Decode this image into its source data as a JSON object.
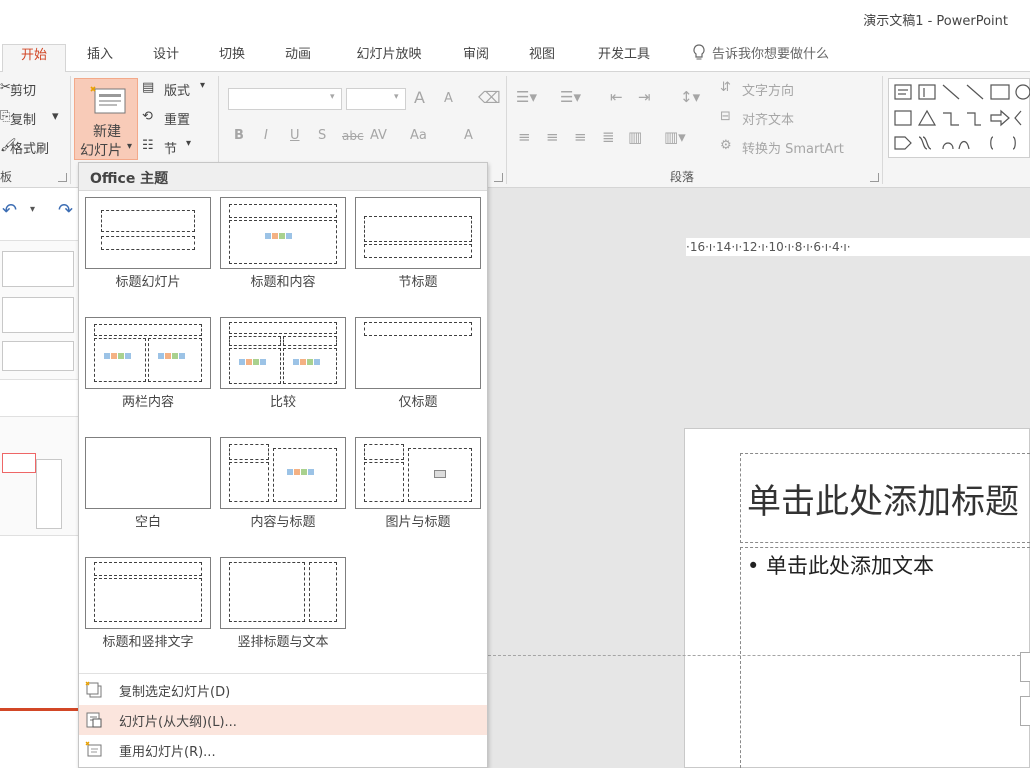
{
  "window": {
    "title": "演示文稿1 - PowerPoint"
  },
  "tabs": [
    {
      "label": "开始",
      "active": true
    },
    {
      "label": "插入"
    },
    {
      "label": "设计"
    },
    {
      "label": "切换"
    },
    {
      "label": "动画"
    },
    {
      "label": "幻灯片放映"
    },
    {
      "label": "审阅"
    },
    {
      "label": "视图"
    },
    {
      "label": "开发工具"
    },
    {
      "label": "告诉我你想要做什么"
    }
  ],
  "ribbon": {
    "clipboard": {
      "cut": "剪切",
      "copy": "复制",
      "format_painter": "格式刷",
      "group_label": "板"
    },
    "slides": {
      "new_slide_line1": "新建",
      "new_slide_line2": "幻灯片",
      "layout": "版式",
      "reset": "重置",
      "section": "节"
    },
    "font": {
      "grow": "A",
      "shrink": "A",
      "bold": "B",
      "italic": "I",
      "underline": "U",
      "shadow": "S",
      "strike": "abc",
      "spacing": "AV",
      "case": "Aa",
      "color": "A"
    },
    "paragraph": {
      "text_direction": "文字方向",
      "align_text": "对齐文本",
      "smartart": "转换为 SmartArt",
      "group_label": "段落"
    }
  },
  "gallery": {
    "header": "Office 主题",
    "layouts": [
      {
        "label": "标题幻灯片"
      },
      {
        "label": "标题和内容"
      },
      {
        "label": "节标题"
      },
      {
        "label": "两栏内容"
      },
      {
        "label": "比较"
      },
      {
        "label": "仅标题"
      },
      {
        "label": "空白"
      },
      {
        "label": "内容与标题"
      },
      {
        "label": "图片与标题"
      },
      {
        "label": "标题和竖排文字"
      },
      {
        "label": "竖排标题与文本"
      }
    ],
    "menu": [
      {
        "label": "复制选定幻灯片(D)",
        "highlighted": false
      },
      {
        "label": "幻灯片(从大纲)(L)...",
        "highlighted": true
      },
      {
        "label": "重用幻灯片(R)..."
      }
    ]
  },
  "ruler": {
    "text": "·16·ı·14·ı·12·ı·10·ı·8·ı·6·ı·4·ı·"
  },
  "slide": {
    "title_placeholder": "单击此处添加标题",
    "body_placeholder": "• 单击此处添加文本"
  },
  "colors": {
    "accent": "#d24726",
    "highlight": "#fbe5dd",
    "button_selected": "#f8cbb8"
  }
}
